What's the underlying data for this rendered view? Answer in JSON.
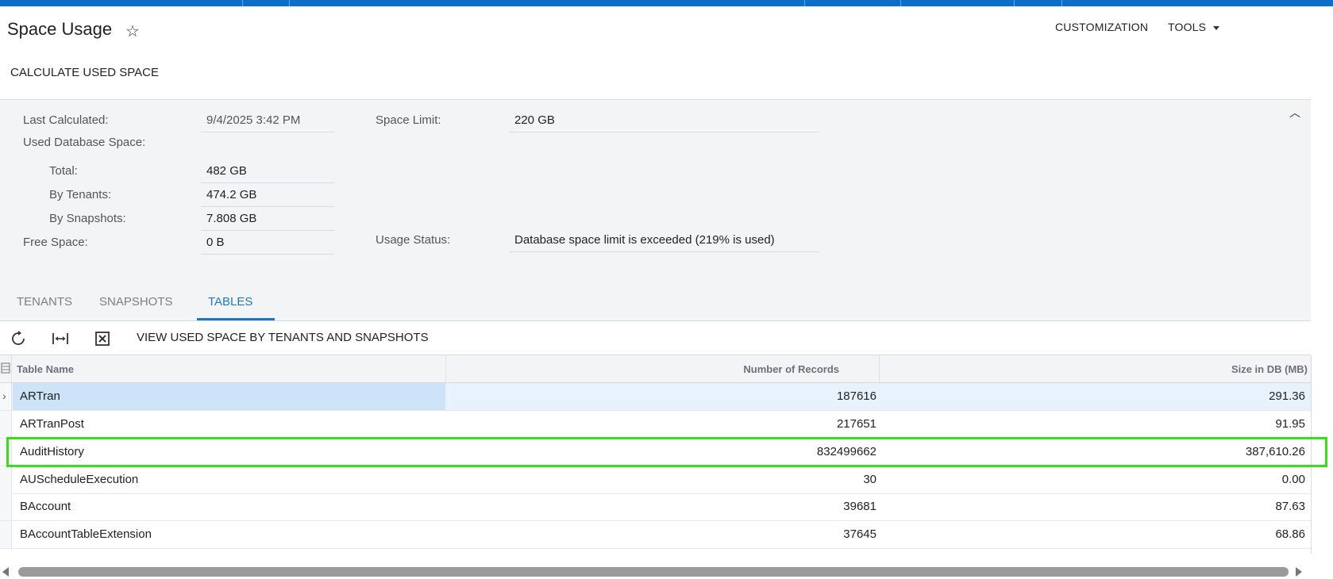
{
  "header": {
    "title": "Space Usage",
    "customization_label": "CUSTOMIZATION",
    "tools_label": "TOOLS"
  },
  "actions": {
    "calculate_label": "CALCULATE USED SPACE"
  },
  "summary": {
    "last_calculated_label": "Last Calculated:",
    "last_calculated_value": "9/4/2025 3:42 PM",
    "used_db_space_label": "Used Database Space:",
    "total_label": "Total:",
    "total_value": "482 GB",
    "by_tenants_label": "By Tenants:",
    "by_tenants_value": "474.2 GB",
    "by_snapshots_label": "By Snapshots:",
    "by_snapshots_value": "7.808 GB",
    "free_space_label": "Free Space:",
    "free_space_value": "0 B",
    "space_limit_label": "Space Limit:",
    "space_limit_value": "220 GB",
    "usage_status_label": "Usage Status:",
    "usage_status_value": "Database space limit is exceeded (219% is used)"
  },
  "tabs": [
    {
      "label": "TENANTS"
    },
    {
      "label": "SNAPSHOTS"
    },
    {
      "label": "TABLES"
    }
  ],
  "toolbar": {
    "view_label": "VIEW USED SPACE BY TENANTS AND SNAPSHOTS"
  },
  "grid": {
    "columns": [
      "Table Name",
      "Number of Records",
      "Size in DB (MB)"
    ],
    "rows": [
      {
        "name": "ARTran",
        "records": "187616",
        "size": "291.36"
      },
      {
        "name": "ARTranPost",
        "records": "217651",
        "size": "91.95"
      },
      {
        "name": "AuditHistory",
        "records": "832499662",
        "size": "387,610.26"
      },
      {
        "name": "AUScheduleExecution",
        "records": "30",
        "size": "0.00"
      },
      {
        "name": "BAccount",
        "records": "39681",
        "size": "87.63"
      },
      {
        "name": "BAccountTableExtension",
        "records": "37645",
        "size": "68.86"
      }
    ]
  },
  "colors": {
    "accent": "#0b6fc7",
    "tab_active": "#1a78c7",
    "highlight": "#3cdc1c"
  },
  "icons": [
    "star-icon",
    "chevron-up-icon",
    "refresh-icon",
    "fit-columns-icon",
    "export-excel-icon",
    "row-chevron-icon"
  ]
}
